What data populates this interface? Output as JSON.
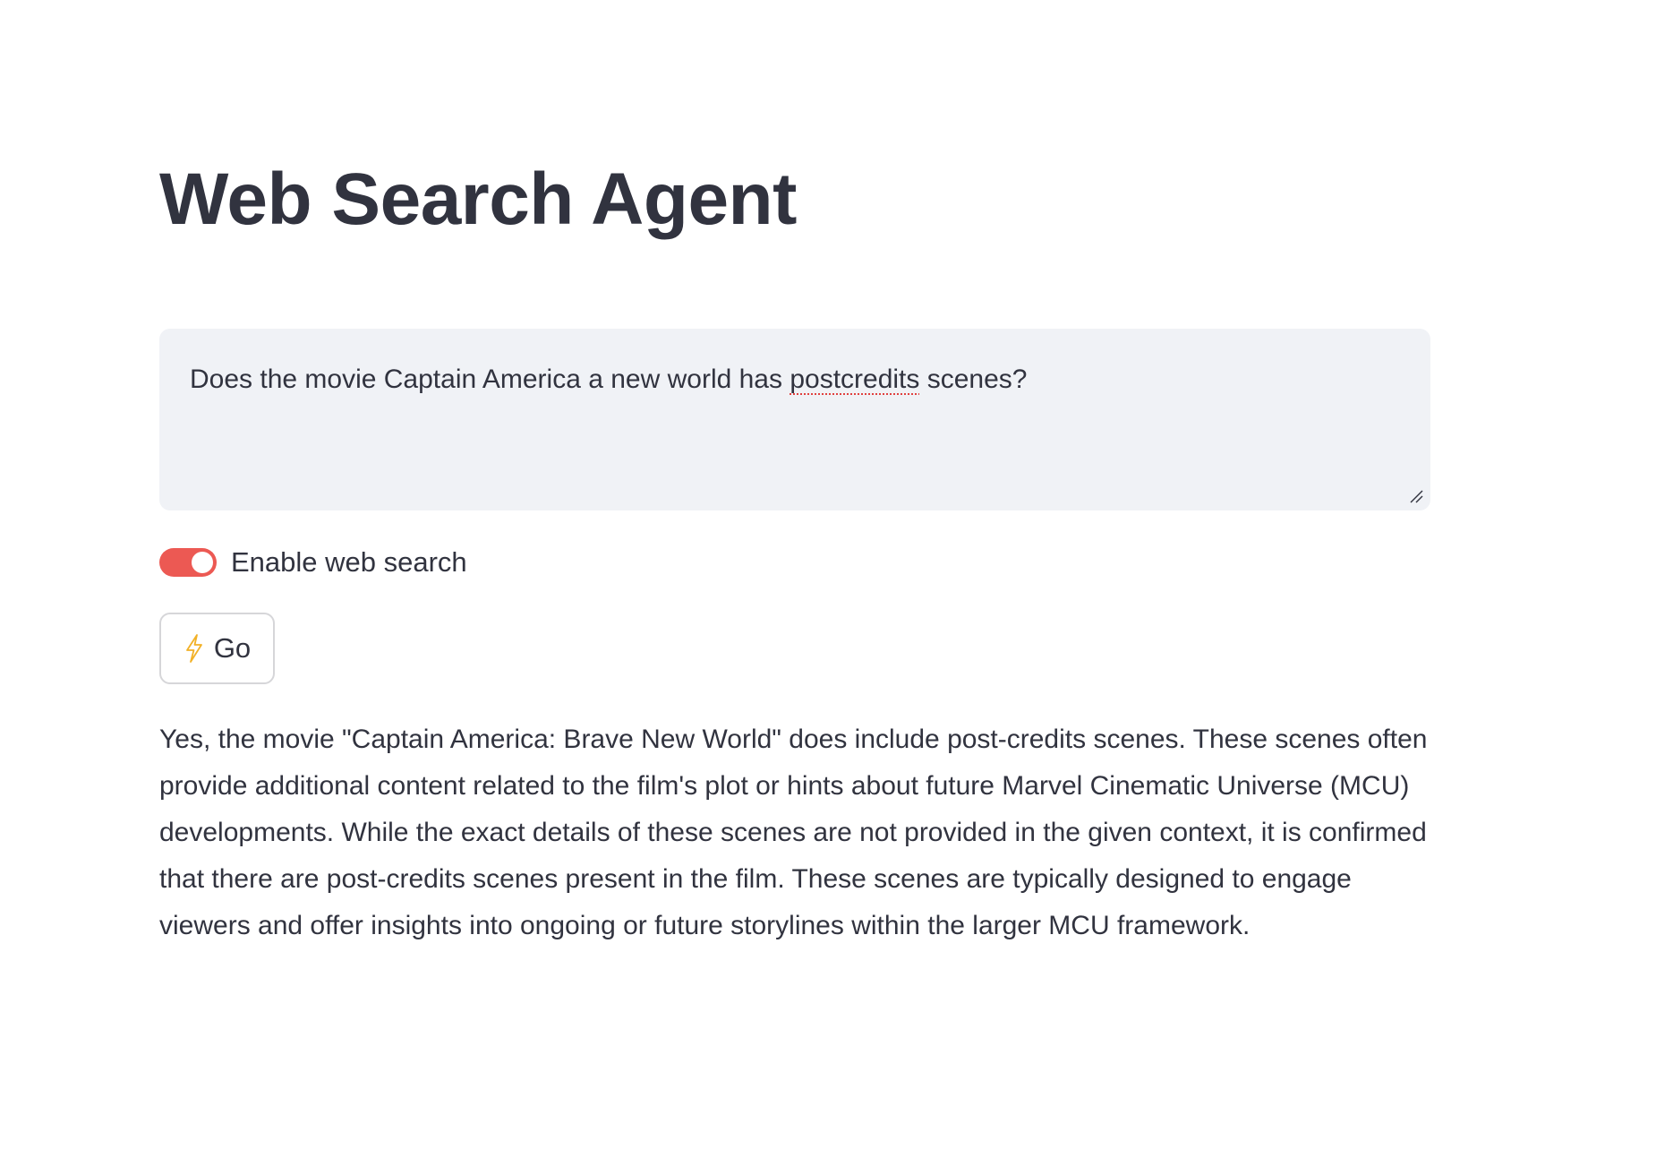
{
  "page": {
    "title": "Web Search Agent"
  },
  "query": {
    "before": "Does the movie Captain America a new world has ",
    "misspelled": "postcredits",
    "after": " scenes?"
  },
  "toggle": {
    "label": "Enable web search",
    "enabled": true,
    "color": "#ec5953"
  },
  "go_button": {
    "icon": "lightning-bolt-icon",
    "label": "Go"
  },
  "answer": {
    "text": "Yes, the movie \"Captain America: Brave New World\" does include post-credits scenes. These scenes often provide additional content related to the film's plot or hints about future Marvel Cinematic Universe (MCU) developments. While the exact details of these scenes are not provided in the given context, it is confirmed that there are post-credits scenes present in the film. These scenes are typically designed to engage viewers and offer insights into ongoing or future storylines within the larger MCU framework."
  }
}
